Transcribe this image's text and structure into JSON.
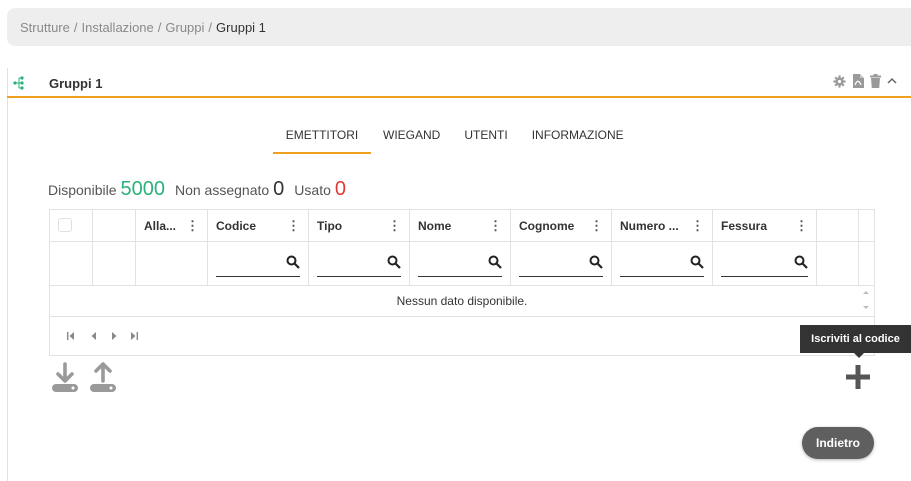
{
  "breadcrumb": {
    "items": [
      "Strutture",
      "Installazione",
      "Gruppi"
    ],
    "separator": "/",
    "current": "Gruppi 1"
  },
  "panel": {
    "title": "Gruppi 1",
    "accent_color": "#f0a020",
    "tools": [
      "gear-icon",
      "pdf-icon",
      "trash-icon",
      "chevron-up-icon"
    ]
  },
  "tabs": [
    {
      "label": "EMETTITORI",
      "active": true
    },
    {
      "label": "WIEGAND",
      "active": false
    },
    {
      "label": "UTENTI",
      "active": false
    },
    {
      "label": "INFORMAZIONE",
      "active": false
    }
  ],
  "counts": {
    "available_label": "Disponibile",
    "available_value": "5000",
    "unassigned_label": "Non assegnato",
    "unassigned_value": "0",
    "used_label": "Usato",
    "used_value": "0",
    "colors": {
      "available": "#2ab27b",
      "unassigned": "#333333",
      "used": "#e53935"
    }
  },
  "grid": {
    "columns": [
      {
        "label": "",
        "menu": ""
      },
      {
        "label": "",
        "menu": ""
      },
      {
        "label": "Alla...",
        "menu": "⋮"
      },
      {
        "label": "Codice",
        "menu": "⋮"
      },
      {
        "label": "Tipo",
        "menu": "⋮"
      },
      {
        "label": "Nome",
        "menu": "⋮"
      },
      {
        "label": "Cognome",
        "menu": "⋮"
      },
      {
        "label": "Numero ...",
        "menu": "⋮"
      },
      {
        "label": "Fessura",
        "menu": "⋮"
      }
    ],
    "empty_message": "Nessun dato disponibile.",
    "pager": [
      "first-page-icon",
      "prev-page-icon",
      "next-page-icon",
      "last-page-icon"
    ]
  },
  "actions": {
    "tooltip": "Iscriviti al codice",
    "back_label": "Indietro"
  }
}
